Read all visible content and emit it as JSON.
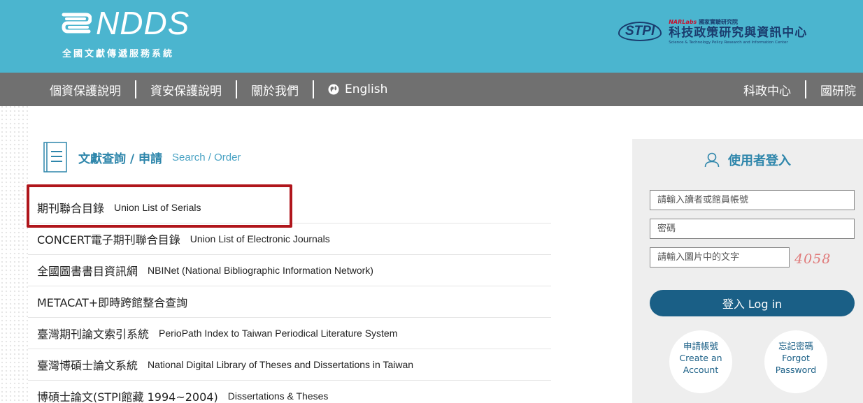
{
  "header": {
    "logo_text": "NDDS",
    "logo_subtitle": "全國文獻傳遞服務系統",
    "partner": {
      "mark": "STPI",
      "top_line_brand": "NARLabs",
      "top_line": "國家實驗研究院",
      "name": "科技政策研究與資訊中心",
      "name_en": "Science & Technology Policy Research and Information Center"
    }
  },
  "nav": {
    "left": [
      "個資保護說明",
      "資安保護說明",
      "關於我們",
      "English"
    ],
    "right": [
      "科政中心",
      "國研院"
    ]
  },
  "section": {
    "title": "文獻查詢 / 申請",
    "title_en": "Search / Order"
  },
  "list": [
    {
      "zh": "期刊聯合目錄",
      "en": "Union List of Serials"
    },
    {
      "zh": "CONCERT電子期刊聯合目錄",
      "en": "Union List of Electronic Journals"
    },
    {
      "zh": "全國圖書書目資訊網",
      "en": "NBINet (National Bibliographic Information Network)"
    },
    {
      "zh": "METACAT+即時跨館整合查詢",
      "en": ""
    },
    {
      "zh": "臺灣期刊論文索引系統",
      "en": "PerioPath Index to Taiwan Periodical Literature System"
    },
    {
      "zh": "臺灣博碩士論文系統",
      "en": "National Digital Library of Theses and Dissertations in Taiwan"
    },
    {
      "zh": "博碩士論文(STPI館藏 1994~2004)",
      "en": "Dissertations & Theses"
    }
  ],
  "login": {
    "title": "使用者登入",
    "account_placeholder": "請輸入讀者或館員帳號",
    "password_placeholder": "密碼",
    "captcha_placeholder": "請輸入圖片中的文字",
    "captcha_code": "4058",
    "login_button": "登入 Log in",
    "create_account": {
      "zh": "申請帳號",
      "en1": "Create an",
      "en2": "Account"
    },
    "forgot_password": {
      "zh": "忘記密碼",
      "en1": "Forgot",
      "en2": "Password"
    }
  },
  "colors": {
    "header_bg": "#4bb5cf",
    "nav_bg": "#707070",
    "accent": "#2e86ab",
    "button": "#1a5f86",
    "highlight": "#b0161c"
  }
}
